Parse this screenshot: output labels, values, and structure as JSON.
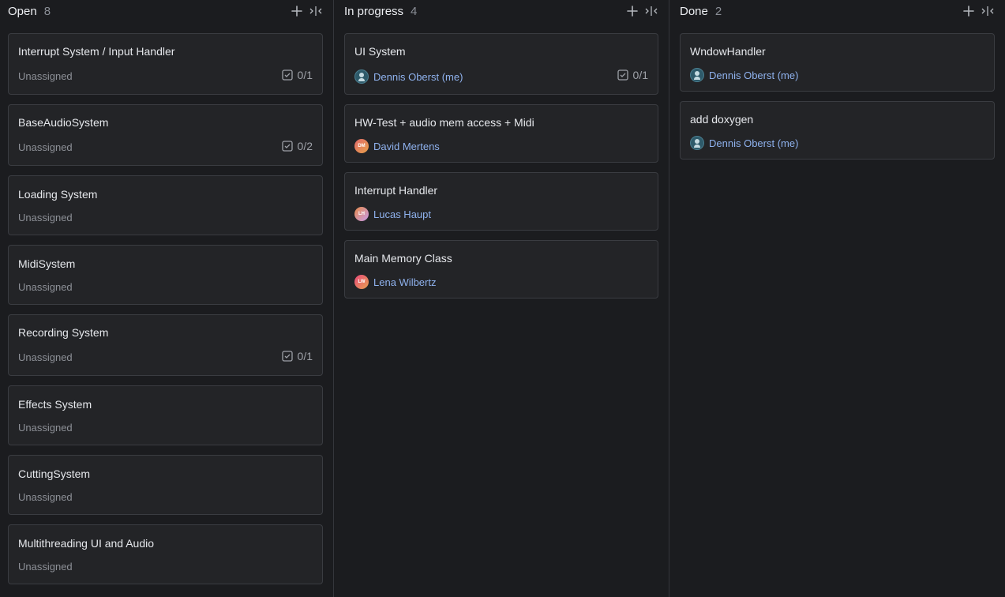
{
  "columns": [
    {
      "title": "Open",
      "count": "8",
      "cards": [
        {
          "title": "Interrupt System / Input Handler",
          "assignee": "Unassigned",
          "tasks": "0/1"
        },
        {
          "title": "BaseAudioSystem",
          "assignee": "Unassigned",
          "tasks": "0/2"
        },
        {
          "title": "Loading System",
          "assignee": "Unassigned"
        },
        {
          "title": "MidiSystem",
          "assignee": "Unassigned"
        },
        {
          "title": "Recording System",
          "assignee": "Unassigned",
          "tasks": "0/1"
        },
        {
          "title": "Effects System",
          "assignee": "Unassigned"
        },
        {
          "title": "CuttingSystem",
          "assignee": "Unassigned"
        },
        {
          "title": "Multithreading UI and Audio",
          "assignee": "Unassigned"
        }
      ]
    },
    {
      "title": "In progress",
      "count": "4",
      "cards": [
        {
          "title": "UI System",
          "assignee": "Dennis Oberst (me)",
          "avatar": "photo",
          "tasks": "0/1"
        },
        {
          "title": "HW-Test + audio mem access + Midi",
          "assignee": "David Mertens",
          "avatar": "DM"
        },
        {
          "title": "Interrupt Handler",
          "assignee": "Lucas Haupt",
          "avatar": "LH"
        },
        {
          "title": "Main Memory Class",
          "assignee": "Lena Wilbertz",
          "avatar": "LW"
        }
      ]
    },
    {
      "title": "Done",
      "count": "2",
      "cards": [
        {
          "title": "WndowHandler",
          "assignee": "Dennis Oberst (me)",
          "avatar": "photo"
        },
        {
          "title": "add doxygen",
          "assignee": "Dennis Oberst (me)",
          "avatar": "photo"
        }
      ]
    }
  ],
  "icons": {
    "add": "plus-icon",
    "collapse": "collapse-column-icon",
    "checklist": "checkbox-checked-icon",
    "avatar_photo": "user-photo-icon"
  },
  "colors": {
    "background": "#1b1c1f",
    "card": "#232427",
    "card_border": "#3a3c41",
    "assignee_link": "#8fb2ee",
    "muted_text": "#8d9097"
  }
}
